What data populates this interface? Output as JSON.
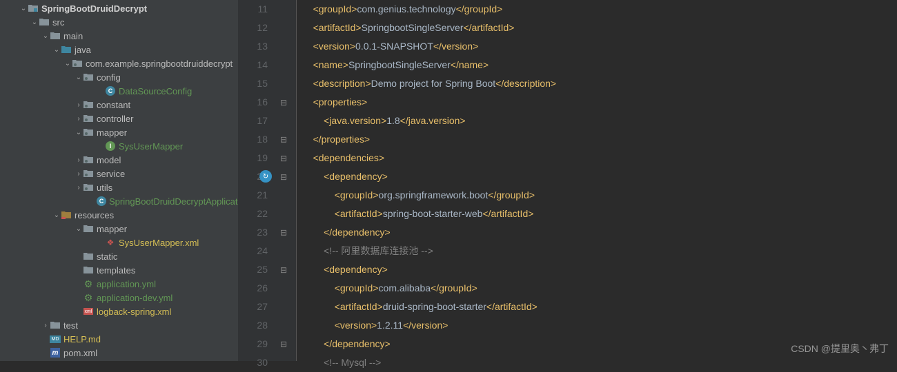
{
  "tree": [
    {
      "indent": 28,
      "arrow": "down",
      "icon": "module",
      "label": "SpringBootDruidDecrypt",
      "cls": "bold"
    },
    {
      "indent": 44,
      "arrow": "down",
      "icon": "folder",
      "label": "src"
    },
    {
      "indent": 60,
      "arrow": "down",
      "icon": "folder",
      "label": "main"
    },
    {
      "indent": 76,
      "arrow": "down",
      "icon": "srcfolder",
      "label": "java"
    },
    {
      "indent": 92,
      "arrow": "down",
      "icon": "pkg",
      "label": "com.example.springbootdruiddecrypt"
    },
    {
      "indent": 108,
      "arrow": "down",
      "icon": "pkg",
      "label": "config"
    },
    {
      "indent": 140,
      "arrow": "",
      "icon": "class",
      "label": "DataSourceConfig",
      "cls": "green"
    },
    {
      "indent": 108,
      "arrow": "right",
      "icon": "pkg",
      "label": "constant"
    },
    {
      "indent": 108,
      "arrow": "right",
      "icon": "pkg",
      "label": "controller"
    },
    {
      "indent": 108,
      "arrow": "down",
      "icon": "pkg",
      "label": "mapper"
    },
    {
      "indent": 140,
      "arrow": "",
      "icon": "iface",
      "label": "SysUserMapper",
      "cls": "green"
    },
    {
      "indent": 108,
      "arrow": "right",
      "icon": "pkg",
      "label": "model"
    },
    {
      "indent": 108,
      "arrow": "right",
      "icon": "pkg",
      "label": "service"
    },
    {
      "indent": 108,
      "arrow": "right",
      "icon": "pkg",
      "label": "utils"
    },
    {
      "indent": 140,
      "arrow": "",
      "icon": "class",
      "label": "SpringBootDruidDecryptApplication",
      "cls": "green"
    },
    {
      "indent": 76,
      "arrow": "down",
      "icon": "resfolder",
      "label": "resources"
    },
    {
      "indent": 108,
      "arrow": "down",
      "icon": "folder",
      "label": "mapper"
    },
    {
      "indent": 140,
      "arrow": "",
      "icon": "xml",
      "label": "SysUserMapper.xml",
      "cls": "yellow"
    },
    {
      "indent": 108,
      "arrow": "",
      "icon": "folder",
      "label": "static"
    },
    {
      "indent": 108,
      "arrow": "",
      "icon": "folder",
      "label": "templates"
    },
    {
      "indent": 108,
      "arrow": "",
      "icon": "yml",
      "label": "application.yml",
      "cls": "green"
    },
    {
      "indent": 108,
      "arrow": "",
      "icon": "yml",
      "label": "application-dev.yml",
      "cls": "green"
    },
    {
      "indent": 108,
      "arrow": "",
      "icon": "xmlr",
      "label": "logback-spring.xml",
      "cls": "yellow"
    },
    {
      "indent": 60,
      "arrow": "right",
      "icon": "folder",
      "label": "test"
    },
    {
      "indent": 60,
      "arrow": "",
      "icon": "md",
      "label": "HELP.md",
      "cls": "yellow"
    },
    {
      "indent": 60,
      "arrow": "",
      "icon": "maven",
      "label": "pom.xml"
    }
  ],
  "code": [
    {
      "n": 11,
      "indent": 4,
      "t": [
        [
          "tag",
          "<groupId>"
        ],
        [
          "val",
          "com.genius.technology"
        ],
        [
          "tag",
          "</groupId>"
        ]
      ]
    },
    {
      "n": 12,
      "indent": 4,
      "t": [
        [
          "tag",
          "<artifactId>"
        ],
        [
          "val",
          "SpringbootSingleServer"
        ],
        [
          "tag",
          "</artifactId>"
        ]
      ]
    },
    {
      "n": 13,
      "indent": 4,
      "t": [
        [
          "tag",
          "<version>"
        ],
        [
          "val",
          "0.0.1-SNAPSHOT"
        ],
        [
          "tag",
          "</version>"
        ]
      ]
    },
    {
      "n": 14,
      "indent": 4,
      "t": [
        [
          "tag",
          "<name>"
        ],
        [
          "val",
          "SpringbootSingleServer"
        ],
        [
          "tag",
          "</name>"
        ]
      ]
    },
    {
      "n": 15,
      "indent": 4,
      "t": [
        [
          "tag",
          "<description>"
        ],
        [
          "val",
          "Demo project for Spring Boot"
        ],
        [
          "tag",
          "</description>"
        ]
      ]
    },
    {
      "n": 16,
      "indent": 4,
      "t": [
        [
          "tag",
          "<properties>"
        ]
      ],
      "fold": "open"
    },
    {
      "n": 17,
      "indent": 8,
      "t": [
        [
          "tag",
          "<java.version>"
        ],
        [
          "val",
          "1.8"
        ],
        [
          "tag",
          "</java.version>"
        ]
      ]
    },
    {
      "n": 18,
      "indent": 4,
      "t": [
        [
          "tag",
          "</properties>"
        ]
      ],
      "fold": "close"
    },
    {
      "n": 19,
      "indent": 4,
      "t": [
        [
          "tag",
          "<dependencies>"
        ]
      ],
      "fold": "open"
    },
    {
      "n": 20,
      "indent": 8,
      "t": [
        [
          "tag",
          "<dependency>"
        ]
      ],
      "fold": "open",
      "dep": true
    },
    {
      "n": 21,
      "indent": 12,
      "t": [
        [
          "tag",
          "<groupId>"
        ],
        [
          "val",
          "org.springframework.boot"
        ],
        [
          "tag",
          "</groupId>"
        ]
      ]
    },
    {
      "n": 22,
      "indent": 12,
      "t": [
        [
          "tag",
          "<artifactId>"
        ],
        [
          "val",
          "spring-boot-starter-web"
        ],
        [
          "tag",
          "</artifactId>"
        ]
      ]
    },
    {
      "n": 23,
      "indent": 8,
      "t": [
        [
          "tag",
          "</dependency>"
        ]
      ],
      "fold": "close"
    },
    {
      "n": 24,
      "indent": 8,
      "t": [
        [
          "comment",
          "<!-- 阿里数据库连接池 -->"
        ]
      ]
    },
    {
      "n": 25,
      "indent": 8,
      "t": [
        [
          "tag",
          "<dependency>"
        ]
      ],
      "fold": "open"
    },
    {
      "n": 26,
      "indent": 12,
      "t": [
        [
          "tag",
          "<groupId>"
        ],
        [
          "val",
          "com.alibaba"
        ],
        [
          "tag",
          "</groupId>"
        ]
      ]
    },
    {
      "n": 27,
      "indent": 12,
      "t": [
        [
          "tag",
          "<artifactId>"
        ],
        [
          "val",
          "druid-spring-boot-starter"
        ],
        [
          "tag",
          "</artifactId>"
        ]
      ]
    },
    {
      "n": 28,
      "indent": 12,
      "t": [
        [
          "tag",
          "<version>"
        ],
        [
          "val",
          "1.2.11"
        ],
        [
          "tag",
          "</version>"
        ]
      ]
    },
    {
      "n": 29,
      "indent": 8,
      "t": [
        [
          "tag",
          "</dependency>"
        ]
      ],
      "fold": "close"
    },
    {
      "n": 30,
      "indent": 8,
      "t": [
        [
          "comment",
          "<!-- Mysql -->"
        ]
      ]
    }
  ],
  "watermark": "CSDN @提里奥丶弗丁"
}
